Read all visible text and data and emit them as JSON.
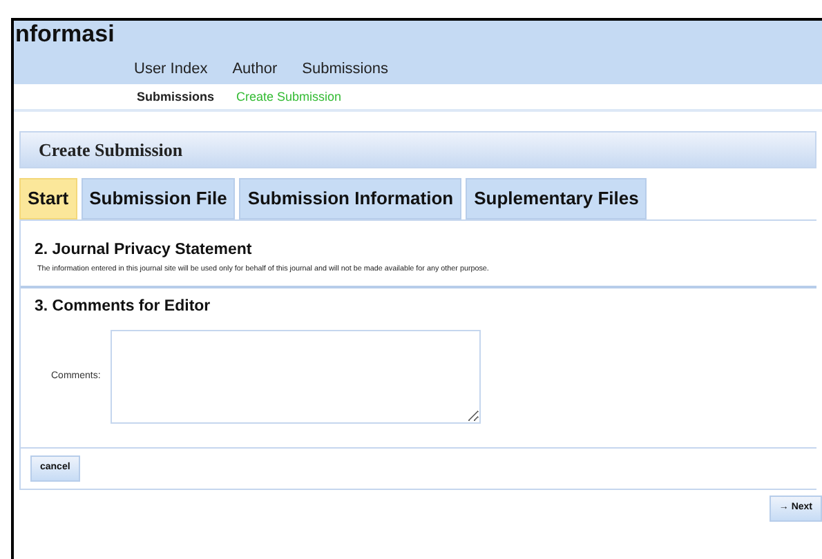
{
  "site_title": "nformasi",
  "nav": [
    {
      "label": "User Index"
    },
    {
      "label": "Author"
    },
    {
      "label": "Submissions"
    }
  ],
  "breadcrumb": [
    {
      "label": "Submissions",
      "selected": false
    },
    {
      "label": "Create Submission",
      "selected": true
    }
  ],
  "page_title": "Create Submission",
  "tabs": [
    {
      "label": "Start",
      "selected": true
    },
    {
      "label": "Submission File",
      "selected": false
    },
    {
      "label": "Submission Information",
      "selected": false
    },
    {
      "label": "Suplementary Files",
      "selected": false
    }
  ],
  "privacy": {
    "heading": "2. Journal Privacy Statement",
    "text": "The information entered in this journal site will be used only for behalf of this journal and will not be made available for any other purpose."
  },
  "comments": {
    "heading": "3. Comments for Editor",
    "label": "Comments:"
  },
  "cancel_button": "cancel",
  "next_button": "→ Next"
}
